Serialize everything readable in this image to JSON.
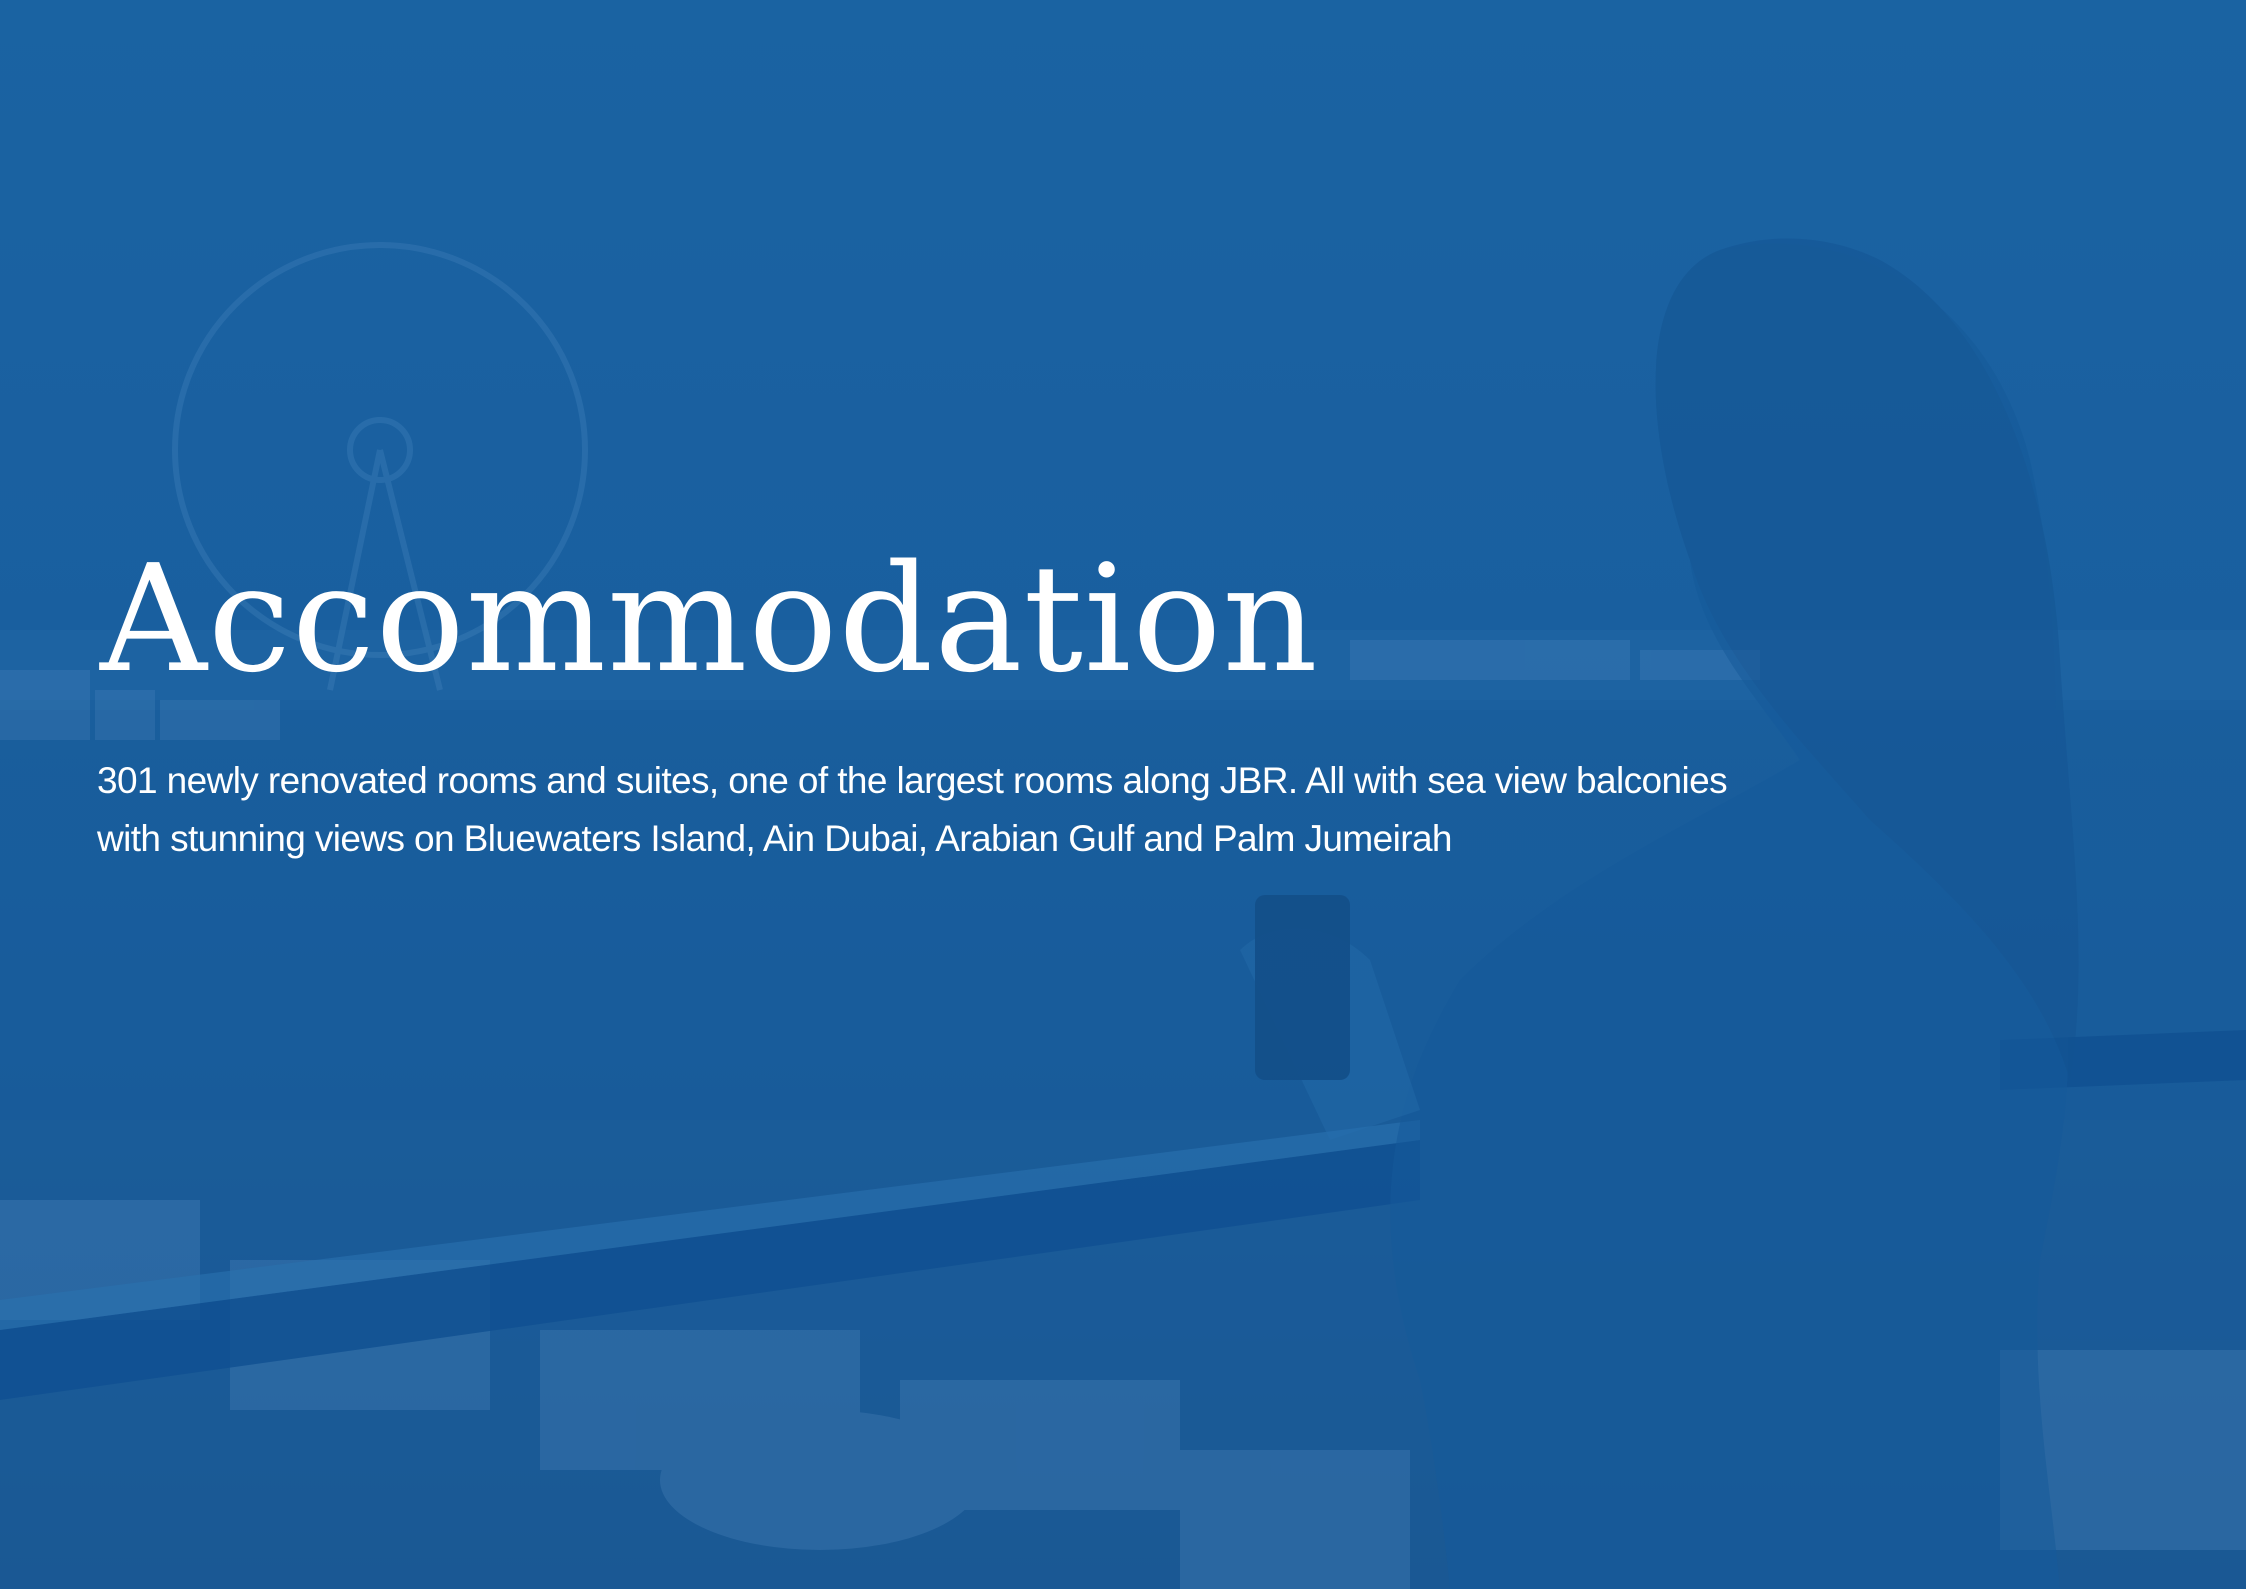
{
  "heading": {
    "title": "Accommodation"
  },
  "description": {
    "line1": "301 newly renovated rooms and suites, one of the largest rooms along JBR. All with sea view balconies",
    "line2": "with stunning views on Bluewaters Island, Ain Dubai, Arabian Gulf and Palm Jumeirah"
  },
  "theme": {
    "overlay_color": "#1b5e9e",
    "text_color": "#ffffff"
  }
}
